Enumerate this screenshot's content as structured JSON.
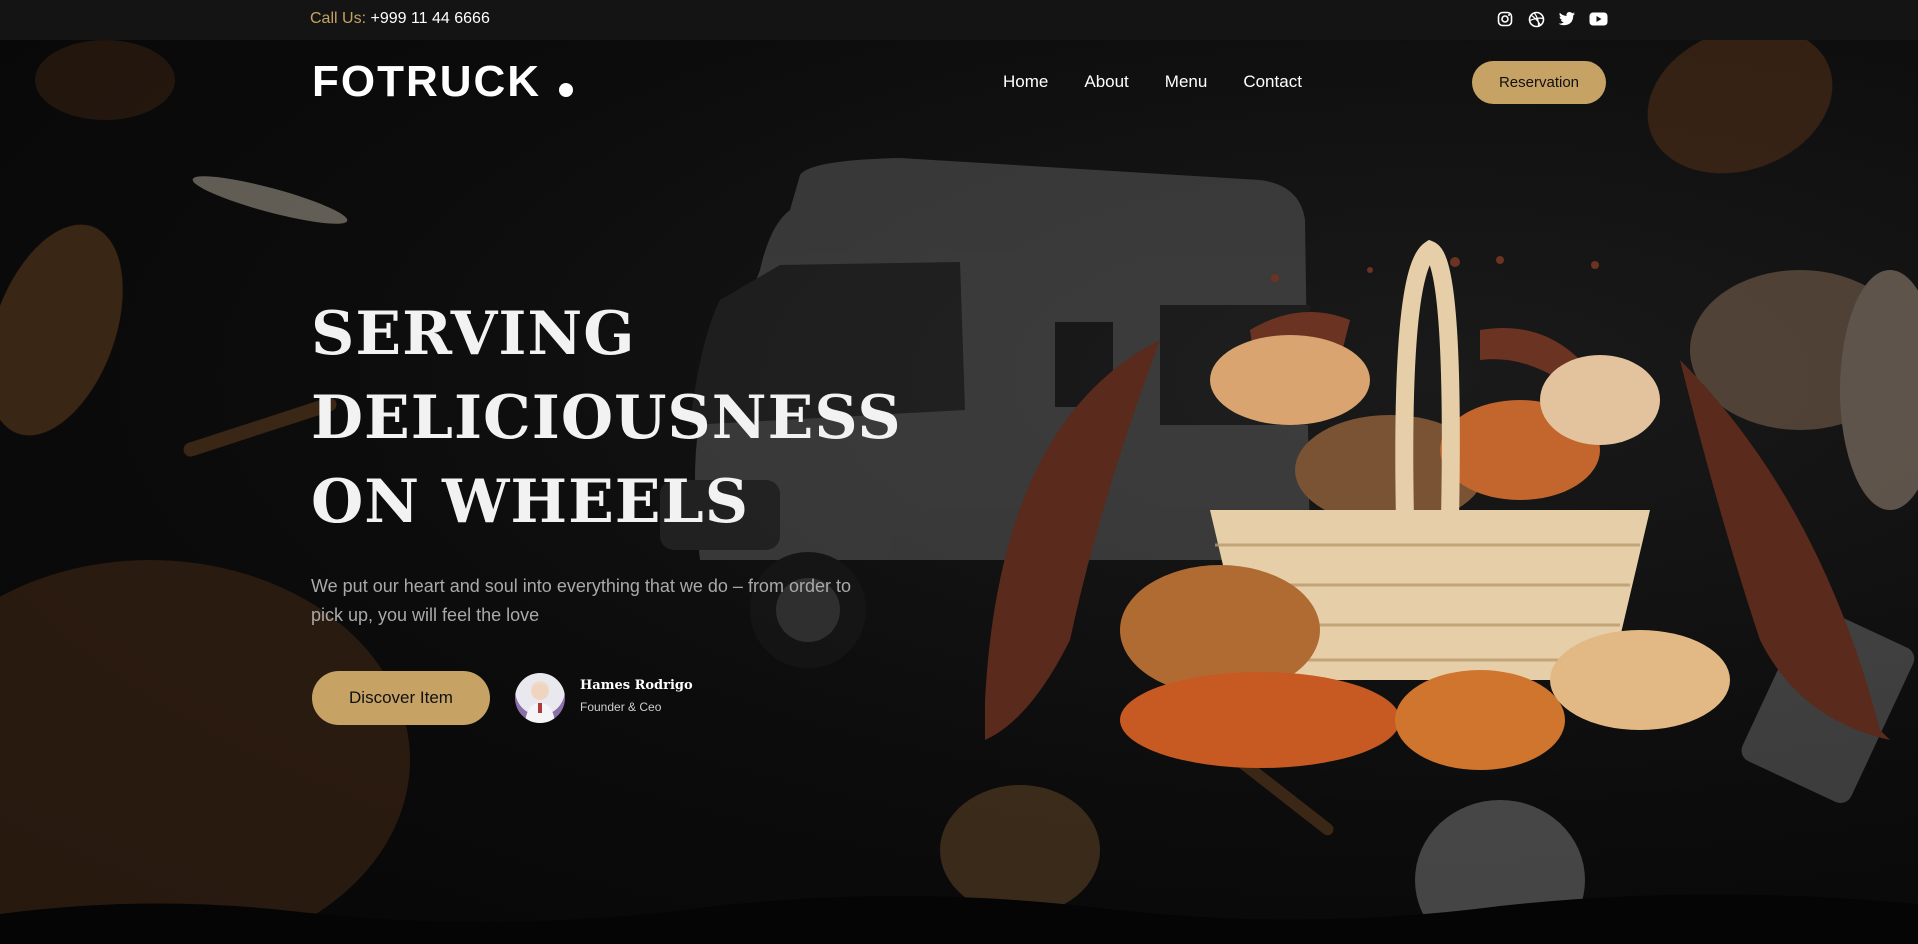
{
  "topbar": {
    "call_label": "Call Us:",
    "phone": "+999 11 44 6666",
    "social_icons": [
      "instagram-icon",
      "dribbble-icon",
      "twitter-icon",
      "youtube-icon"
    ]
  },
  "header": {
    "logo_text": "FOTRUCK",
    "nav": [
      "Home",
      "About",
      "Menu",
      "Contact"
    ],
    "reservation_label": "Reservation"
  },
  "hero": {
    "headline": [
      "SERVING",
      "DELICIOUSNESS",
      "ON WHEELS"
    ],
    "subtext": "We put our heart and soul into everything that we do – from order to pick up, you will feel the love",
    "cta_label": "Discover Item",
    "person": {
      "name": "Hames Rodrigo",
      "role": "Founder & Ceo"
    }
  },
  "colors": {
    "accent": "#c6a265",
    "background": "#0a0a0a",
    "topbar": "#141414",
    "chocolate": "#5a2a1c"
  }
}
